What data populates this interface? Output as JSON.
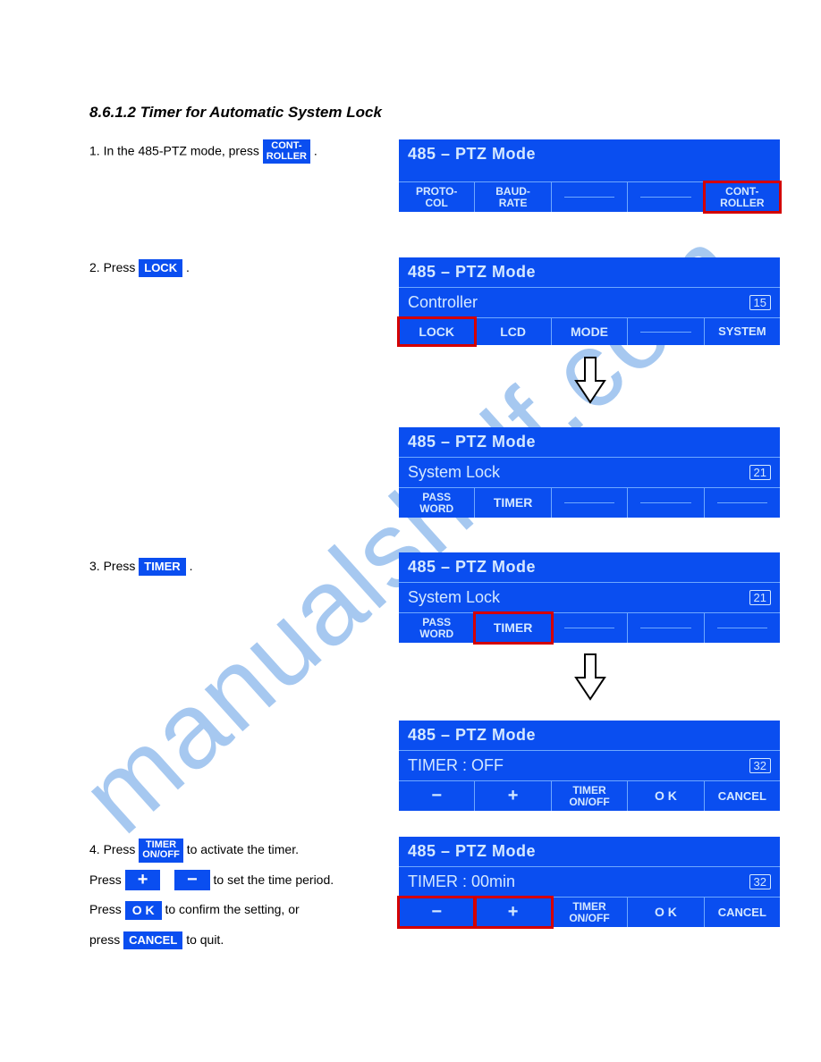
{
  "watermark": "manualshelf.com",
  "heading": "8.6.1.2 Timer for Automatic System Lock",
  "step1": {
    "prefix": "1. In the 485-PTZ mode, press ",
    "label": "CONT-\nROLLER",
    "suffix": "."
  },
  "step2": {
    "prefix": "2. Press ",
    "label": "LOCK",
    "suffix": "."
  },
  "step3": {
    "prefix": "3. Press ",
    "label": "TIMER",
    "suffix": "."
  },
  "step4": {
    "line1_a": "4. Press ",
    "label_timer_onoff": "TIMER\nON/OFF",
    "line1_b": " to activate the timer.",
    "label_plus": "+",
    "label_minus": "−",
    "line2_a": "Press ",
    "line2_b": " to set the time period.",
    "label_ok": "O K",
    "label_cancel": "CANCEL",
    "line3_a": "Press ",
    "line3_b": " to confirm the setting, or ",
    "line4_a": "press ",
    "line4_b": " to quit."
  },
  "lcd_common": {
    "title": "485 – PTZ Mode"
  },
  "screen1": {
    "cells": [
      "PROTO-\nCOL",
      "BAUD-\nRATE",
      "",
      "",
      "CONT-\nROLLER"
    ]
  },
  "screen2": {
    "subtitle": "Controller",
    "badge": "15",
    "cells": [
      "LOCK",
      "LCD",
      "MODE",
      "",
      "SYSTEM"
    ]
  },
  "screen3": {
    "subtitle": "System Lock",
    "badge": "21",
    "cells": [
      "PASS\nWORD",
      "TIMER",
      "",
      "",
      ""
    ]
  },
  "screen4": {
    "subtitle": "System Lock",
    "badge": "21",
    "cells": [
      "PASS\nWORD",
      "TIMER",
      "",
      "",
      ""
    ]
  },
  "screen5": {
    "subtitle": "TIMER : OFF",
    "badge": "32",
    "cells": [
      "−",
      "+",
      "TIMER\nON/OFF",
      "O K",
      "CANCEL"
    ]
  },
  "screen6": {
    "subtitle": "TIMER : 00min",
    "badge": "32",
    "cells": [
      "−",
      "+",
      "TIMER\nON/OFF",
      "O K",
      "CANCEL"
    ]
  }
}
